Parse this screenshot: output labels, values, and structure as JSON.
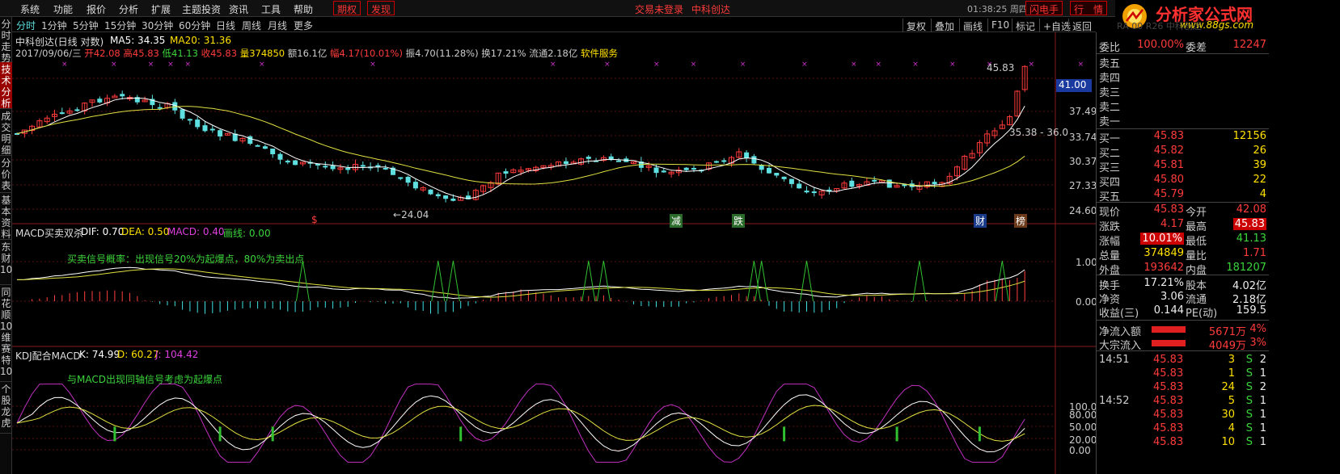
{
  "menu": {
    "items": [
      "系统",
      "功能",
      "报价",
      "分析",
      "扩展",
      "主题投资",
      "资讯",
      "工具",
      "帮助"
    ],
    "red_btns": [
      "期权",
      "发现"
    ],
    "center_text": "交易未登录",
    "stock_name_top": "中科创达",
    "time": "01:38:25 周四",
    "flash_btn": "闪电手",
    "hangqing_btn": "行　情"
  },
  "logo": {
    "main": "分析家公式网",
    "url": "www.88gs.com",
    "faded": "RA 00 R26 中科创达"
  },
  "periods": {
    "items": [
      "分时",
      "1分钟",
      "5分钟",
      "15分钟",
      "30分钟",
      "60分钟",
      "日线",
      "周线",
      "月线",
      "更多"
    ],
    "active": "日线",
    "tools": [
      "复权",
      "叠加",
      "画线",
      "F10",
      "标记",
      "+自选",
      "返回"
    ]
  },
  "sidebar": {
    "tabs": [
      "分时走势",
      "技术分析",
      "成交明细",
      "分价表",
      "基本资料",
      "东财10",
      "同花顺10",
      "维赛特10",
      "个股龙虎"
    ]
  },
  "main_chart": {
    "title": "中科创达(日线 对数)",
    "ma5_label": "MA5: 34.35",
    "ma20_label": "MA20: 31.36",
    "info_date": "2017/09/06/三",
    "info_open": "开42.08",
    "info_high": "高45.83",
    "info_low": "低41.13",
    "info_close": "收45.83",
    "info_vol": "量374850",
    "info_amt": "额16.1亿",
    "info_chg": "幅4.17(10.01%)",
    "info_amp": "振4.70(11.28%)",
    "info_turn": "换17.21%",
    "info_float": "流通2.18亿",
    "info_sector": "软件服务",
    "price_high_label": "45.83",
    "price_low_label": "24.04",
    "range_label": "35.38 - 36.0",
    "current_price_tag": "41.00",
    "y_ticks": [
      "41.00",
      "37.49",
      "33.74",
      "30.37",
      "27.33",
      "24.60"
    ],
    "signal_labels": [
      "$",
      "减",
      "跌",
      "财",
      "榜"
    ]
  },
  "macd_panel": {
    "title": "MACD买卖双杀",
    "dif": "DIF: 0.70",
    "dea": "DEA: 0.50",
    "macd": "MACD: 0.40",
    "line": "画线: 0.00",
    "note": "买卖信号概率：出现信号20%为起爆点，80%为卖出点",
    "y_ticks": [
      "1.00",
      "0.00"
    ]
  },
  "kdj_panel": {
    "title": "KDJ配合MACD",
    "k": "K: 74.99",
    "d": "D: 60.27",
    "j": "J: 104.42",
    "note": "与MACD出现同轴信号考虑为起爆点",
    "y_ticks": [
      "100.00",
      "80.00",
      "50.00",
      "20.00",
      "0.00"
    ]
  },
  "quote": {
    "weibi_label": "委比",
    "weibi_value": "100.00%",
    "weicha_label": "委差",
    "weicha_value": "12247",
    "sells": [
      {
        "label": "卖五",
        "price": "",
        "vol": ""
      },
      {
        "label": "卖四",
        "price": "",
        "vol": ""
      },
      {
        "label": "卖三",
        "price": "",
        "vol": ""
      },
      {
        "label": "卖二",
        "price": "",
        "vol": ""
      },
      {
        "label": "卖一",
        "price": "",
        "vol": ""
      }
    ],
    "buys": [
      {
        "label": "买一",
        "price": "45.83",
        "vol": "12156"
      },
      {
        "label": "买二",
        "price": "45.82",
        "vol": "26"
      },
      {
        "label": "买三",
        "price": "45.81",
        "vol": "39"
      },
      {
        "label": "买四",
        "price": "45.80",
        "vol": "22"
      },
      {
        "label": "买五",
        "price": "45.79",
        "vol": "4"
      }
    ],
    "stats": [
      {
        "l1": "现价",
        "v1": "45.83",
        "c1": "red",
        "l2": "今开",
        "v2": "42.08",
        "c2": "red"
      },
      {
        "l1": "涨跌",
        "v1": "4.17",
        "c1": "red",
        "l2": "最高",
        "v2": "45.83",
        "c2": "red",
        "box2": true
      },
      {
        "l1": "涨幅",
        "v1": "10.01%",
        "c1": "red",
        "box1": true,
        "l2": "最低",
        "v2": "41.13",
        "c2": "green"
      },
      {
        "l1": "总量",
        "v1": "374849",
        "c1": "yellow",
        "l2": "量比",
        "v2": "1.71",
        "c2": "red"
      },
      {
        "l1": "外盘",
        "v1": "193642",
        "c1": "red",
        "l2": "内盘",
        "v2": "181207",
        "c2": "green"
      }
    ],
    "stats2": [
      {
        "l1": "换手",
        "v1": "17.21%",
        "c1": "white",
        "l2": "股本",
        "v2": "4.02亿",
        "c2": "white"
      },
      {
        "l1": "净资",
        "v1": "3.06",
        "c1": "white",
        "l2": "流通",
        "v2": "2.18亿",
        "c2": "white"
      },
      {
        "l1": "收益(三)",
        "v1": "0.144",
        "c1": "white",
        "l2": "PE(动)",
        "v2": "159.5",
        "c2": "white"
      }
    ],
    "flows": [
      {
        "label": "净流入额",
        "value": "5671万",
        "pct": "4%"
      },
      {
        "label": "大宗流入",
        "value": "4049万",
        "pct": "3%"
      }
    ],
    "ticks": [
      {
        "time": "14:51",
        "price": "45.83",
        "vol": "3",
        "side": "S",
        "n": "2"
      },
      {
        "time": "",
        "price": "45.83",
        "vol": "1",
        "side": "S",
        "n": "1"
      },
      {
        "time": "",
        "price": "45.83",
        "vol": "24",
        "side": "S",
        "n": "2"
      },
      {
        "time": "14:52",
        "price": "45.83",
        "vol": "5",
        "side": "S",
        "n": "1"
      },
      {
        "time": "",
        "price": "45.83",
        "vol": "30",
        "side": "S",
        "n": "1"
      },
      {
        "time": "",
        "price": "45.83",
        "vol": "4",
        "side": "S",
        "n": "1"
      },
      {
        "time": "",
        "price": "45.83",
        "vol": "10",
        "side": "S",
        "n": "1"
      }
    ]
  },
  "colors": {
    "up": "#ff3b3b",
    "down": "#5ee0e0",
    "ma5": "#ffffff",
    "ma20": "#e0e040",
    "macd_pos": "#ff4040",
    "macd_neg": "#40e0e0",
    "signal": "#30c030",
    "kdj_j": "#c030c0"
  }
}
